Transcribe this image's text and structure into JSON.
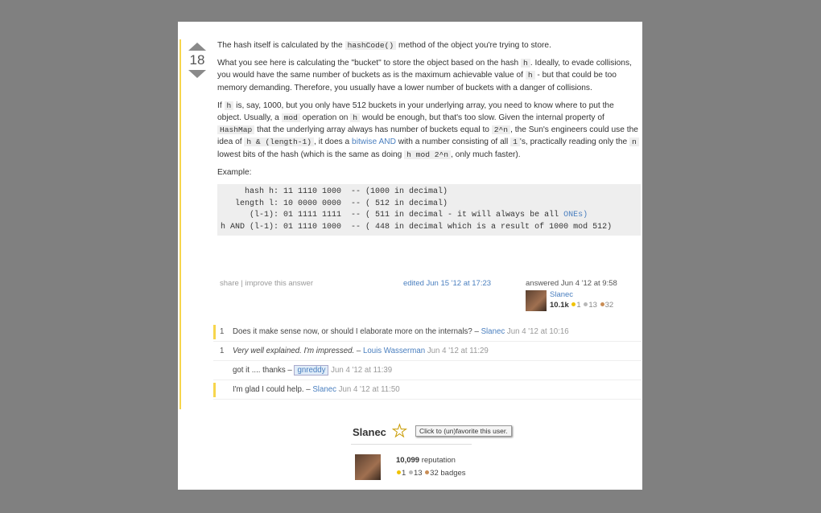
{
  "answer": {
    "vote_count": "18",
    "p1": {
      "a": "The hash itself is calculated by the ",
      "code1": "hashCode()",
      "b": " method of the object you're trying to store."
    },
    "p2": {
      "a": "What you see here is calculating the \"bucket\" to store the object based on the hash ",
      "code1": "h",
      "b": ". Ideally, to evade collisions, you would have the same number of buckets as is the maximum achievable value of ",
      "code2": "h",
      "c": " - but that could be too memory demanding. Therefore, you usually have a lower number of buckets with a danger of collisions."
    },
    "p3": {
      "a": "If ",
      "code1": "h",
      "b": " is, say, 1000, but you only have 512 buckets in your underlying array, you need to know where to put the object. Usually, a ",
      "code2": "mod",
      "c": " operation on ",
      "code3": "h",
      "d": " would be enough, but that's too slow. Given the internal property of ",
      "code4": "HashMap",
      "e": " that the underlying array always has number of buckets equal to ",
      "code5": "2^n",
      "f": ", the Sun's engineers could use the idea of ",
      "code6": "h & (length-1)",
      "g": ", it does a ",
      "link1": "bitwise AND",
      "h": " with a number consisting of all ",
      "code7": "1",
      "i": "'s, practically reading only the ",
      "code8": "n",
      "j": " lowest bits of the hash (which is the same as doing ",
      "code9": "h mod 2^n",
      "k": ", only much faster)."
    },
    "example_label": "Example:",
    "code_lines": [
      {
        "text": "     hash h: 11 1110 1000  -- (1000 in decimal)",
        "extra": ""
      },
      {
        "text": "   length l: 10 0000 0000  -- ( 512 in decimal)",
        "extra": ""
      },
      {
        "text": "      (l-1): 01 1111 1111  -- ( 511 in decimal - it will always be all ",
        "extra": "ONEs)"
      },
      {
        "text": "h AND (l-1): 01 1110 1000  -- ( 448 in decimal which is a result of 1000 mod 512)",
        "extra": ""
      }
    ]
  },
  "meta": {
    "share": "share",
    "sep": " | ",
    "improve": "improve this answer",
    "edited": "edited Jun 15 '12 at 17:23",
    "answered": "answered Jun 4 '12 at 9:58",
    "user_name": "Slanec",
    "user_rep": "10.1k",
    "gold": "1",
    "silver": "13",
    "bronze": "32"
  },
  "comments": [
    {
      "score": "1",
      "text": "Does it make sense now, or should I elaborate more on the internals? – ",
      "user": "Slanec",
      "time": " Jun 4 '12 at 10:16",
      "highlight": true,
      "italic": false,
      "user_boxed": false
    },
    {
      "score": "1",
      "text": "Very well explained. I'm impressed. – ",
      "user": "Louis Wasserman",
      "time": " Jun 4 '12 at 11:29",
      "highlight": false,
      "italic": true,
      "user_boxed": false
    },
    {
      "score": "",
      "text": "got it .... thanks – ",
      "user": "gnreddy",
      "time": " Jun 4 '12 at 11:39",
      "highlight": false,
      "italic": false,
      "user_boxed": true
    },
    {
      "score": "",
      "text": "I'm glad I could help. – ",
      "user": "Slanec",
      "time": " Jun 4 '12 at 11:50",
      "highlight": true,
      "italic": false,
      "user_boxed": false
    }
  ],
  "profile": {
    "name": "Slanec",
    "star_icon": "star-icon",
    "tooltip": "Click to (un)favorite this user.",
    "reputation_value": "10,099",
    "reputation_label": " reputation",
    "gold": "1",
    "silver": "13",
    "bronze": "32",
    "badges_label": " badges"
  },
  "colors": {
    "accent": "#4a7fbf",
    "highlight": "#f7d54c",
    "background": "#808080"
  }
}
